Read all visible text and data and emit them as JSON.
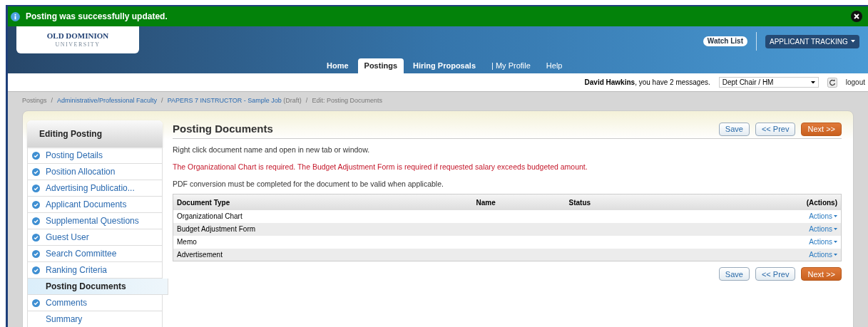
{
  "notification": {
    "message": "Posting was successfully updated."
  },
  "header": {
    "logo": {
      "name": "OLD DOMINION",
      "subtitle": "UNIVERSITY"
    },
    "watch_list": "Watch List",
    "module_select": "APPLICANT TRACKING"
  },
  "nav": [
    {
      "label": "Home",
      "selected": false
    },
    {
      "label": "Postings",
      "selected": true
    },
    {
      "label": "Hiring Proposals",
      "selected": false
    },
    {
      "label": "| My Profile",
      "selected": false
    },
    {
      "label": "Help",
      "selected": false
    }
  ],
  "user_bar": {
    "user": "David Hawkins",
    "message": ", you have 2 messages.",
    "role": "Dept Chair / HM",
    "logout": "logout"
  },
  "breadcrumb": [
    {
      "text": "Postings",
      "kind": "plain"
    },
    {
      "text": "Administrative/Professional Faculty",
      "kind": "link",
      "separator": "/"
    },
    {
      "text": "PAPERS 7 INSTRUCTOR - Sample Job",
      "kind": "link",
      "suffix": "(Draft)",
      "separator": "/"
    },
    {
      "text": "Edit: Posting Documents",
      "kind": "plain",
      "separator": "/"
    }
  ],
  "sidebar": {
    "title": "Editing Posting",
    "items": [
      {
        "label": "Posting Details",
        "completed": true,
        "selected": false
      },
      {
        "label": "Position Allocation",
        "completed": true,
        "selected": false
      },
      {
        "label": "Advertising Publicatio...",
        "completed": true,
        "selected": false
      },
      {
        "label": "Applicant Documents",
        "completed": true,
        "selected": false
      },
      {
        "label": "Supplemental Questions",
        "completed": true,
        "selected": false
      },
      {
        "label": "Guest User",
        "completed": true,
        "selected": false
      },
      {
        "label": "Search Committee",
        "completed": true,
        "selected": false
      },
      {
        "label": "Ranking Criteria",
        "completed": true,
        "selected": false
      },
      {
        "label": "Posting Documents",
        "completed": false,
        "selected": true
      },
      {
        "label": "Comments",
        "completed": true,
        "selected": false
      },
      {
        "label": "Summary",
        "completed": false,
        "selected": false
      }
    ]
  },
  "main": {
    "title": "Posting Documents",
    "buttons": {
      "save": "Save",
      "prev": "<< Prev",
      "next": "Next >>"
    },
    "notes": [
      {
        "text": "Right click document name and open in new tab or window.",
        "kind": "info"
      },
      {
        "text": "The Organizational Chart is required.  The Budget Adjustment Form is required if requested salary exceeds budgeted amount.",
        "kind": "error"
      },
      {
        "text": "PDF conversion must be completed for the document to be valid when applicable.",
        "kind": "info"
      }
    ],
    "table": {
      "columns": [
        "Document Type",
        "Name",
        "Status",
        "(Actions)"
      ],
      "rows": [
        {
          "document_type": "Organizational Chart",
          "actions": "Actions"
        },
        {
          "document_type": "Budget Adjustment Form",
          "actions": "Actions"
        },
        {
          "document_type": "Memo",
          "actions": "Actions"
        },
        {
          "document_type": "Advertisement",
          "actions": "Actions"
        }
      ]
    },
    "bottom_buttons": {
      "save": "Save",
      "prev": "<< Prev",
      "next": "Next >>"
    }
  }
}
